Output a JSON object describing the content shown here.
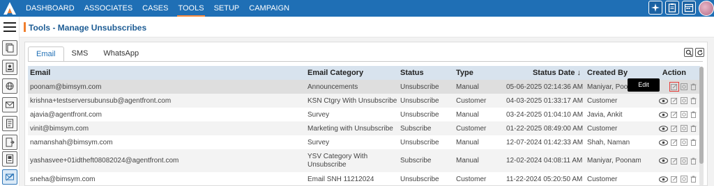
{
  "nav": {
    "items": [
      {
        "label": "DASHBOARD"
      },
      {
        "label": "ASSOCIATES"
      },
      {
        "label": "CASES"
      },
      {
        "label": "TOOLS"
      },
      {
        "label": "SETUP"
      },
      {
        "label": "CAMPAIGN"
      }
    ],
    "active_index": 3,
    "top_icons": [
      "sparkle-icon",
      "clipboard-icon",
      "calendar-icon"
    ]
  },
  "page": {
    "title": "Tools - Manage Unsubscribes"
  },
  "tabs": [
    {
      "label": "Email"
    },
    {
      "label": "SMS"
    },
    {
      "label": "WhatsApp"
    }
  ],
  "table": {
    "headers": {
      "email": "Email",
      "category": "Email Category",
      "status": "Status",
      "type": "Type",
      "status_date": "Status Date",
      "sort_arrow": "↓",
      "created_by": "Created By",
      "action": "Action"
    },
    "rows": [
      {
        "email": "poonam@bimsym.com",
        "category": "Announcements",
        "status": "Unsubscribe",
        "type": "Manual",
        "date": "05-06-2025 02:14:36 AM",
        "created_by": "Maniyar, Poonam"
      },
      {
        "email": "krishna+testserversubunsub@agentfront.com",
        "category": "KSN Ctgry With Unsubscribe",
        "status": "Unsubscribe",
        "type": "Customer",
        "date": "04-03-2025 01:33:17 AM",
        "created_by": "Customer"
      },
      {
        "email": "ajavia@agentfront.com",
        "category": "Survey",
        "status": "Unsubscribe",
        "type": "Manual",
        "date": "03-24-2025 01:04:10 AM",
        "created_by": "Javia, Ankit"
      },
      {
        "email": "vinit@bimsym.com",
        "category": "Marketing with Unsubscribe",
        "status": "Subscribe",
        "type": "Customer",
        "date": "01-22-2025 08:49:00 AM",
        "created_by": "Customer"
      },
      {
        "email": "namanshah@bimsym.com",
        "category": "Survey",
        "status": "Unsubscribe",
        "type": "Manual",
        "date": "12-07-2024 01:42:33 AM",
        "created_by": "Shah, Naman"
      },
      {
        "email": "yashasvee+01idtheft08082024@agentfront.com",
        "category": "YSV Category With Unsubscribe",
        "status": "Subscribe",
        "type": "Manual",
        "date": "12-02-2024 04:08:11 AM",
        "created_by": "Maniyar, Poonam"
      },
      {
        "email": "sneha@bimsym.com",
        "category": "Email SNH 11212024",
        "status": "Unsubscribe",
        "type": "Customer",
        "date": "11-22-2024 05:20:50 AM",
        "created_by": "Customer"
      }
    ]
  },
  "tooltip": {
    "text": "Edit"
  },
  "colors": {
    "nav_bg": "#1f6fb5",
    "accent": "#f07e2d",
    "header_row": "#d8e3ee",
    "highlight": "#e53935"
  }
}
